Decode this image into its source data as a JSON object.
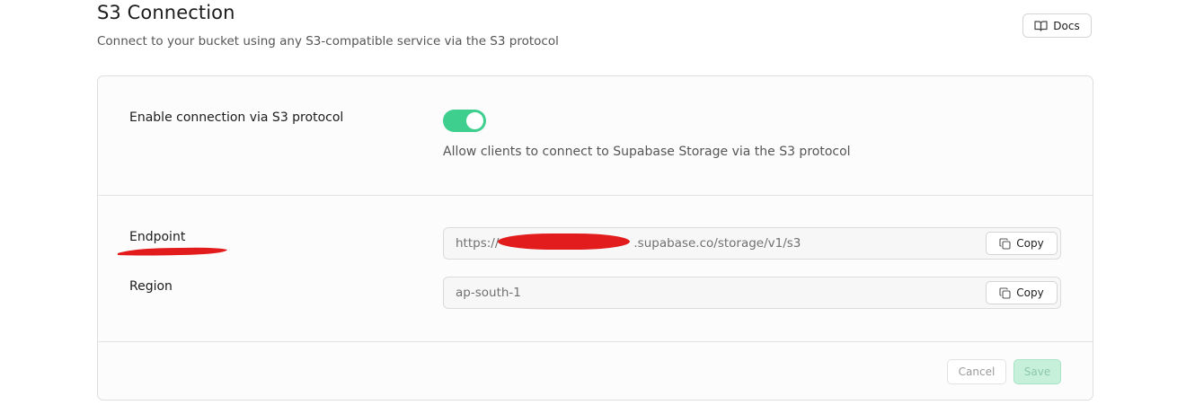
{
  "header": {
    "title": "S3 Connection",
    "subtitle": "Connect to your bucket using any S3-compatible service via the S3 protocol",
    "docs_label": "Docs",
    "docs_icon": "book-open-icon"
  },
  "settings": {
    "enable": {
      "label": "Enable connection via S3 protocol",
      "enabled": true,
      "description": "Allow clients to connect to Supabase Storage via the S3 protocol"
    },
    "endpoint": {
      "label": "Endpoint",
      "value_prefix": "https://",
      "value_suffix": ".supabase.co/storage/v1/s3",
      "copy_label": "Copy",
      "copy_icon": "copy-icon"
    },
    "region": {
      "label": "Region",
      "value": "ap-south-1",
      "copy_label": "Copy",
      "copy_icon": "copy-icon"
    }
  },
  "footer": {
    "cancel_label": "Cancel",
    "save_label": "Save"
  },
  "colors": {
    "accent": "#3ecf8e",
    "redaction": "#e21c1c"
  }
}
